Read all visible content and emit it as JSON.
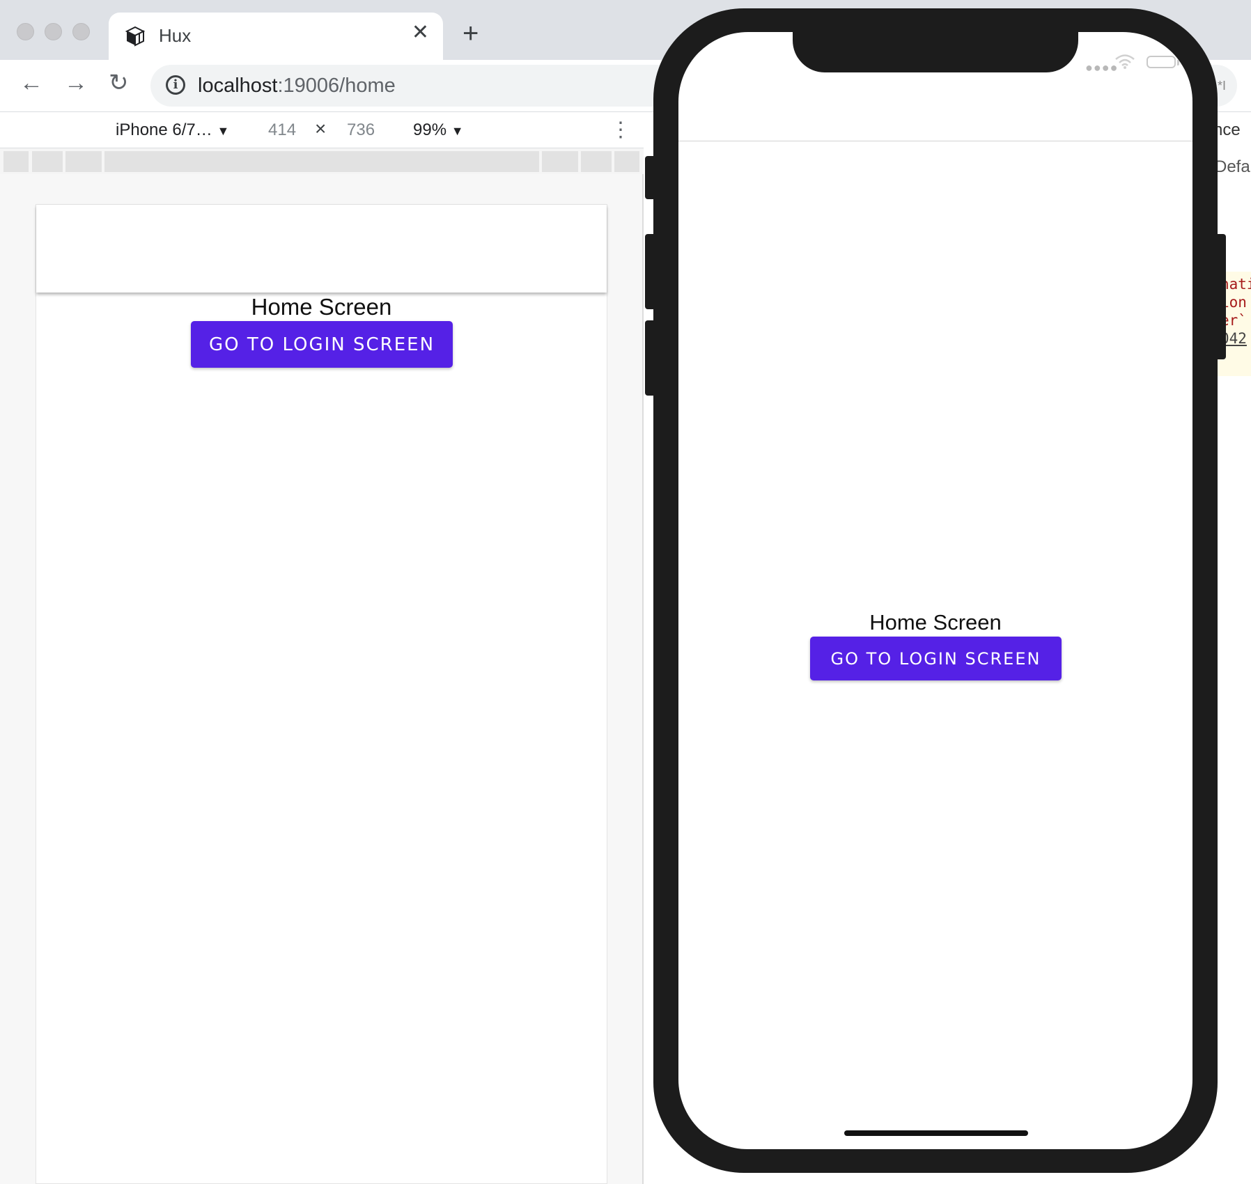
{
  "browser": {
    "tab": {
      "title": "Hux",
      "close_glyph": "✕"
    },
    "new_tab_glyph": "+",
    "nav": {
      "back_glyph": "←",
      "forward_glyph": "→",
      "reload_glyph": "↻"
    },
    "url": {
      "host": "localhost",
      "rest": ":19006/home"
    },
    "info_glyph": "i"
  },
  "device_toolbar": {
    "device": "iPhone 6/7…",
    "device_dropdown_glyph": "▼",
    "width": "414",
    "times_glyph": "×",
    "height": "736",
    "zoom": "99%",
    "zoom_dropdown_glyph": "▼",
    "more_glyph": "⋮"
  },
  "devtools_glimpse": {
    "top_text": "*I",
    "tab_text": "nce",
    "row_text": "Defau",
    "code_lines": [
      "nati",
      "ion",
      "er`",
      "042"
    ]
  },
  "app": {
    "screen_title": "Home Screen",
    "login_button_label": "GO TO LOGIN SCREEN"
  },
  "colors": {
    "primary": "#5521e6",
    "phone_frame": "#1c1c1c",
    "tabbar": "#dee1e6"
  },
  "icons": {
    "tab_favicon": "cube-icon",
    "wifi": "wifi-icon",
    "battery": "battery-icon"
  }
}
